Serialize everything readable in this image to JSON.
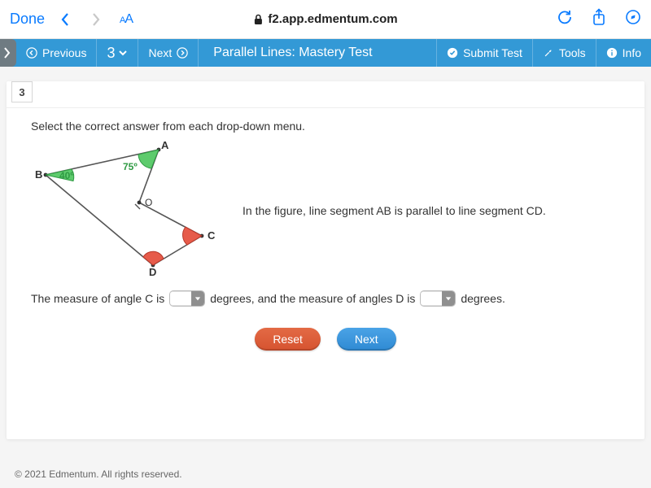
{
  "browser": {
    "done": "Done",
    "url": "f2.app.edmentum.com"
  },
  "appbar": {
    "previous": "Previous",
    "qnum": "3",
    "next": "Next",
    "title": "Parallel Lines: Mastery Test",
    "submit": "Submit Test",
    "tools": "Tools",
    "info": "Info"
  },
  "question": {
    "number": "3",
    "instruction": "Select the correct answer from each drop-down menu.",
    "figure_caption": "In the figure, line segment AB is parallel to line segment CD.",
    "labels": {
      "A": "A",
      "B": "B",
      "C": "C",
      "D": "D",
      "O": "O",
      "ang75": "75º",
      "ang40": "40º"
    },
    "answer_parts": {
      "p1": "The measure of angle C is",
      "p2": "degrees, and the measure of angles D is",
      "p3": "degrees."
    },
    "reset": "Reset",
    "next": "Next"
  },
  "footer": "© 2021 Edmentum. All rights reserved."
}
